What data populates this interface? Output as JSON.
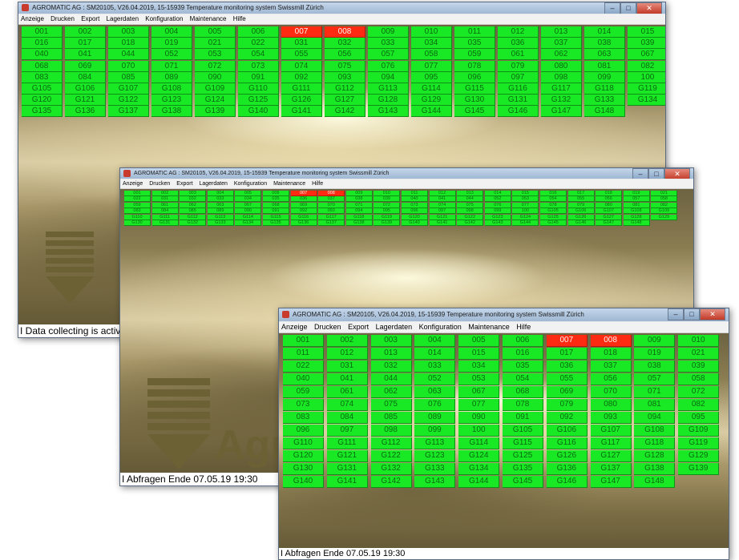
{
  "window_title": "AGROMATIC AG : SM20105, V26.04.2019, 15-15939 Temperature monitoring system Swissmill Zürich",
  "menu": [
    "Anzeige",
    "Drucken",
    "Export",
    "Lagerdaten",
    "Konfiguration",
    "Maintenance",
    "Hilfe"
  ],
  "window_controls": {
    "minimize": "–",
    "maximize": "□",
    "close": "✕"
  },
  "colors": {
    "ok": "#19e825",
    "alarm": "#ff2a12"
  },
  "logo_text": "Agro",
  "windows": [
    {
      "id": "large",
      "status": "I Data collecting is active ag",
      "alarm_cells": [
        "007",
        "008"
      ],
      "rows": [
        [
          "001",
          "002",
          "003",
          "004",
          "005",
          "006",
          "007",
          "008",
          "009",
          "010",
          "011",
          "012",
          "013",
          "014",
          "015"
        ],
        [
          "016",
          "017",
          "018",
          "019",
          "021",
          "022",
          "031",
          "032",
          "033",
          "034",
          "035",
          "036",
          "037",
          "038",
          "039"
        ],
        [
          "040",
          "041",
          "044",
          "052",
          "053",
          "054",
          "055",
          "056",
          "057",
          "058",
          "059",
          "061",
          "062",
          "063",
          "067"
        ],
        [
          "068",
          "069",
          "070",
          "071",
          "072",
          "073",
          "074",
          "075",
          "076",
          "077",
          "078",
          "079",
          "080",
          "081",
          "082"
        ],
        [
          "083",
          "084",
          "085",
          "089",
          "090",
          "091",
          "092",
          "093",
          "094",
          "095",
          "096",
          "097",
          "098",
          "099",
          "100"
        ],
        [
          "G105",
          "G106",
          "G107",
          "G108",
          "G109",
          "G110",
          "G111",
          "G112",
          "G113",
          "G114",
          "G115",
          "G116",
          "G117",
          "G118",
          "G119"
        ],
        [
          "G120",
          "G121",
          "G122",
          "G123",
          "G124",
          "G125",
          "G126",
          "G127",
          "G128",
          "G129",
          "G130",
          "G131",
          "G132",
          "G133",
          "G134"
        ],
        [
          "G135",
          "G136",
          "G137",
          "G138",
          "G139",
          "G140",
          "G141",
          "G142",
          "G143",
          "G144",
          "G145",
          "G146",
          "G147",
          "G148"
        ]
      ]
    },
    {
      "id": "medium",
      "status": "I Abfragen Ende  07.05.19 19:30",
      "alarm_cells": [
        "007",
        "008"
      ],
      "rows": [
        [
          "001",
          "002",
          "003",
          "004",
          "005",
          "006",
          "007",
          "008",
          "009",
          "010",
          "011",
          "012",
          "013",
          "014",
          "015",
          "016",
          "017",
          "018",
          "019",
          "021"
        ],
        [
          "022",
          "031",
          "032",
          "033",
          "034",
          "035",
          "036",
          "037",
          "038",
          "039",
          "040",
          "041",
          "044",
          "052",
          "053",
          "054",
          "055",
          "056",
          "057",
          "058"
        ],
        [
          "059",
          "061",
          "062",
          "063",
          "067",
          "068",
          "069",
          "070",
          "071",
          "072",
          "073",
          "074",
          "075",
          "076",
          "077",
          "078",
          "079",
          "080",
          "081",
          "082"
        ],
        [
          "083",
          "084",
          "085",
          "089",
          "090",
          "091",
          "092",
          "093",
          "094",
          "095",
          "096",
          "097",
          "098",
          "099",
          "100",
          "G105",
          "G106",
          "G107",
          "G108",
          "G109"
        ],
        [
          "G110",
          "G111",
          "G112",
          "G113",
          "G114",
          "G115",
          "G116",
          "G117",
          "G118",
          "G119",
          "G120",
          "G121",
          "G122",
          "G123",
          "G124",
          "G125",
          "G126",
          "G127",
          "G128",
          "G129"
        ],
        [
          "G130",
          "G131",
          "G132",
          "G133",
          "G134",
          "G135",
          "G136",
          "G137",
          "G138",
          "G139",
          "G140",
          "G141",
          "G142",
          "G143",
          "G144",
          "G145",
          "G146",
          "G147",
          "G148"
        ]
      ]
    },
    {
      "id": "small",
      "status": "I Abfragen Ende  07.05.19 19:30",
      "alarm_cells": [
        "007",
        "008"
      ],
      "rows": [
        [
          "001",
          "002",
          "003",
          "004",
          "005",
          "006",
          "007",
          "008",
          "009",
          "010"
        ],
        [
          "011",
          "012",
          "013",
          "014",
          "015",
          "016",
          "017",
          "018",
          "019",
          "021"
        ],
        [
          "022",
          "031",
          "032",
          "033",
          "034",
          "035",
          "036",
          "037",
          "038",
          "039"
        ],
        [
          "040",
          "041",
          "044",
          "052",
          "053",
          "054",
          "055",
          "056",
          "057",
          "058"
        ],
        [
          "059",
          "061",
          "062",
          "063",
          "067",
          "068",
          "069",
          "070",
          "071",
          "072"
        ],
        [
          "073",
          "074",
          "075",
          "076",
          "077",
          "078",
          "079",
          "080",
          "081",
          "082"
        ],
        [
          "083",
          "084",
          "085",
          "089",
          "090",
          "091",
          "092",
          "093",
          "094",
          "095"
        ],
        [
          "096",
          "097",
          "098",
          "099",
          "100",
          "G105",
          "G106",
          "G107",
          "G108",
          "G109"
        ],
        [
          "G110",
          "G111",
          "G112",
          "G113",
          "G114",
          "G115",
          "G116",
          "G117",
          "G118",
          "G119"
        ],
        [
          "G120",
          "G121",
          "G122",
          "G123",
          "G124",
          "G125",
          "G126",
          "G127",
          "G128",
          "G129"
        ],
        [
          "G130",
          "G131",
          "G132",
          "G133",
          "G134",
          "G135",
          "G136",
          "G137",
          "G138",
          "G139"
        ],
        [
          "G140",
          "G141",
          "G142",
          "G143",
          "G144",
          "G145",
          "G146",
          "G147",
          "G148"
        ]
      ]
    }
  ]
}
